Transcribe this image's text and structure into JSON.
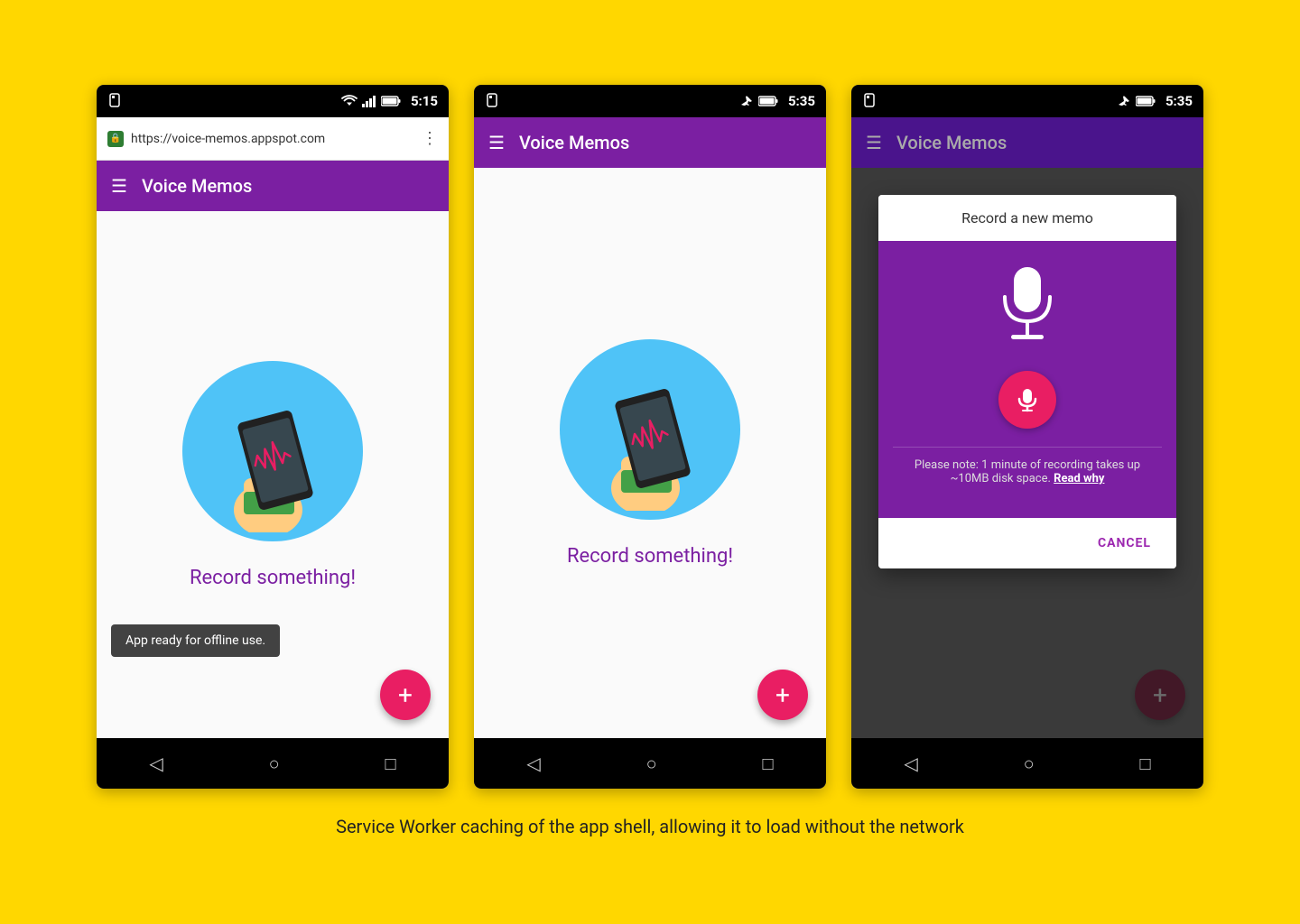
{
  "background_color": "#FFD700",
  "caption": "Service Worker caching of the app shell, allowing it to load without the network",
  "phone1": {
    "status_bar": {
      "time": "5:15",
      "has_url_bar": true
    },
    "url_bar": {
      "url": "https://voice-memos.appspot.com",
      "has_lock": true
    },
    "app_bar": {
      "title": "Voice Memos",
      "hamburger": "☰"
    },
    "content": {
      "record_label": "Record something!"
    },
    "toast": "App ready for offline use.",
    "fab_label": "+"
  },
  "phone2": {
    "status_bar": {
      "time": "5:35"
    },
    "app_bar": {
      "title": "Voice Memos",
      "hamburger": "☰"
    },
    "content": {
      "record_label": "Record something!"
    },
    "fab_label": "+"
  },
  "phone3": {
    "status_bar": {
      "time": "5:35"
    },
    "app_bar": {
      "title": "Voice Memos",
      "hamburger": "☰",
      "dimmed": true
    },
    "dialog": {
      "header": "Record a new memo",
      "note": "Please note: 1 minute of recording takes up ~10MB disk space.",
      "note_link": "Read why",
      "cancel_button": "CANCEL"
    },
    "fab_label": "+"
  },
  "nav": {
    "back": "◁",
    "home": "○",
    "recent": "□"
  }
}
